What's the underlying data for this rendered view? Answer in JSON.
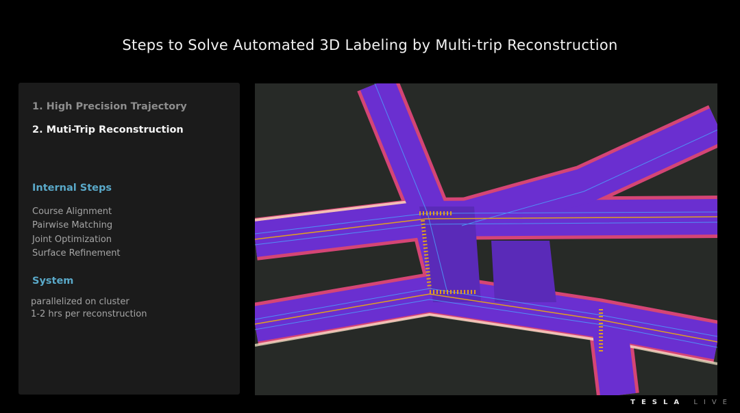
{
  "title": "Steps to Solve Automated 3D Labeling by Multi-trip Reconstruction",
  "panel": {
    "steps": [
      "1. High Precision Trajectory",
      "2. Muti-Trip Reconstruction"
    ],
    "internal_heading": "Internal Steps",
    "internal_items": [
      "Course Alignment",
      "Pairwise Matching",
      "Joint Optimization",
      "Surface Refinement"
    ],
    "system_heading": "System",
    "system_items": [
      "parallelized on cluster",
      "1-2 hrs per reconstruction"
    ]
  },
  "branding": {
    "tesla": "TESLA",
    "live": "LIVE"
  },
  "colors": {
    "road": "#6a2fd0",
    "edge": "#e8487e",
    "lane": "#4aa8ff",
    "crosswalk": "#e0a020"
  }
}
